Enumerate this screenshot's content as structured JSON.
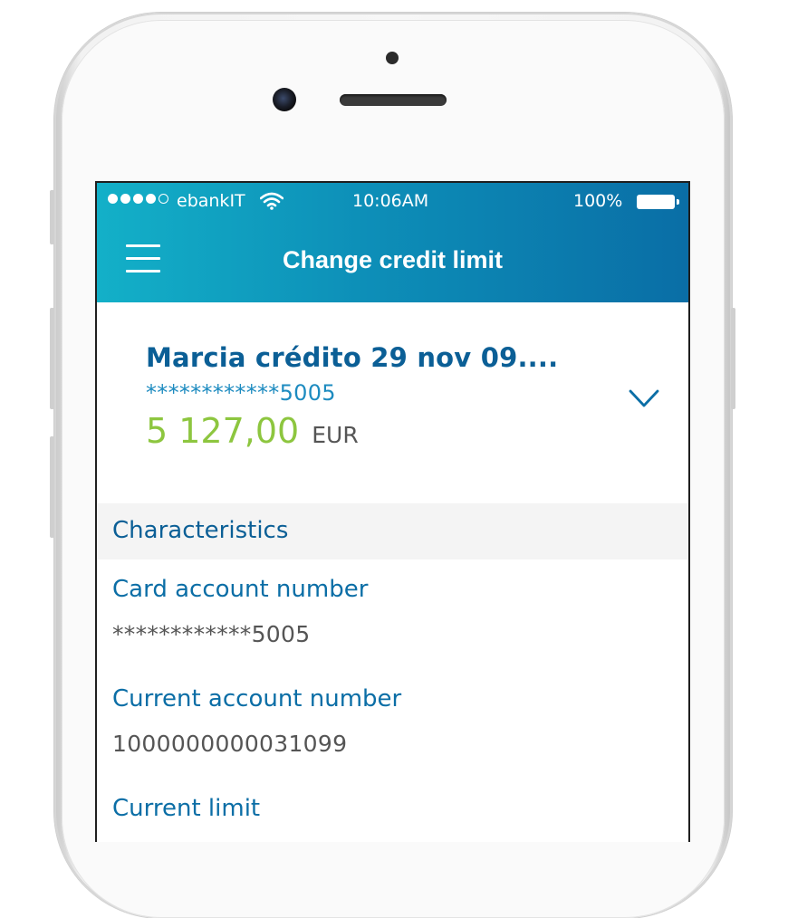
{
  "status_bar": {
    "carrier": "ebankIT",
    "time": "10:06AM",
    "battery": "100%"
  },
  "header": {
    "title": "Change credit limit",
    "menu_icon": "hamburger-menu-icon"
  },
  "account": {
    "name": "Marcia crédito 29 nov 09....",
    "number": "************5005",
    "balance": "5 127,00",
    "currency": "EUR",
    "expand_icon": "chevron-down-icon"
  },
  "characteristics": {
    "title": "Characteristics",
    "fields": [
      {
        "label": "Card account number",
        "value": "************5005"
      },
      {
        "label": "Current account number",
        "value": "1000000000031099"
      },
      {
        "label": "Current limit",
        "value": ""
      }
    ]
  },
  "colors": {
    "header_gradient_start": "#13b0c8",
    "header_gradient_end": "#0a6ea6",
    "primary_text": "#0b5f96",
    "balance_green": "#8dc63f",
    "section_bg": "#f4f4f4"
  }
}
